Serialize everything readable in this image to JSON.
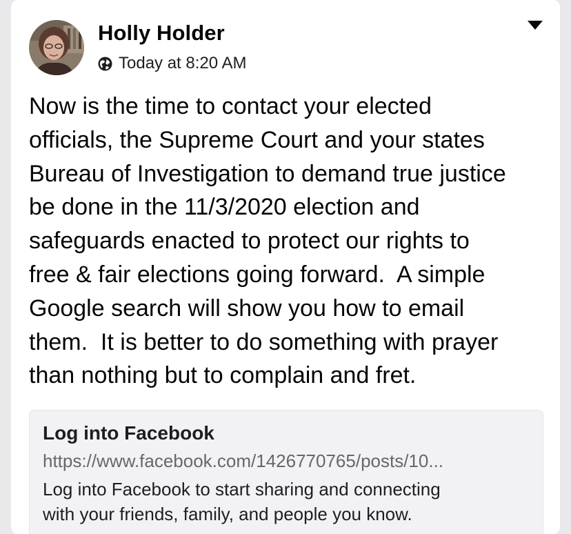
{
  "post": {
    "author_name": "Holly Holder",
    "timestamp": "Today at 8:20 AM",
    "privacy_icon": "globe-icon",
    "menu_icon": "caret-down-icon",
    "body_lines": [
      "Now is the time to contact your elected",
      "officials, the Supreme Court and your states",
      "Bureau of Investigation to demand true justice",
      "be done in the 11/3/2020 election and",
      "safeguards enacted to protect our rights to",
      "free & fair elections going forward.  A simple",
      "Google search will show you how to email",
      "them.  It is better to do something with prayer",
      "than nothing but to complain and fret."
    ]
  },
  "link_preview": {
    "title": "Log into Facebook",
    "url": "https://www.facebook.com/1426770765/posts/10...",
    "description_lines": [
      "Log into Facebook to start sharing and connecting",
      "with your friends, family, and people you know."
    ]
  },
  "colors": {
    "background": "#e9e9eb",
    "card": "#ffffff",
    "text": "#050505",
    "secondary_text": "#65676b",
    "link_card_bg": "#f2f2f4"
  }
}
